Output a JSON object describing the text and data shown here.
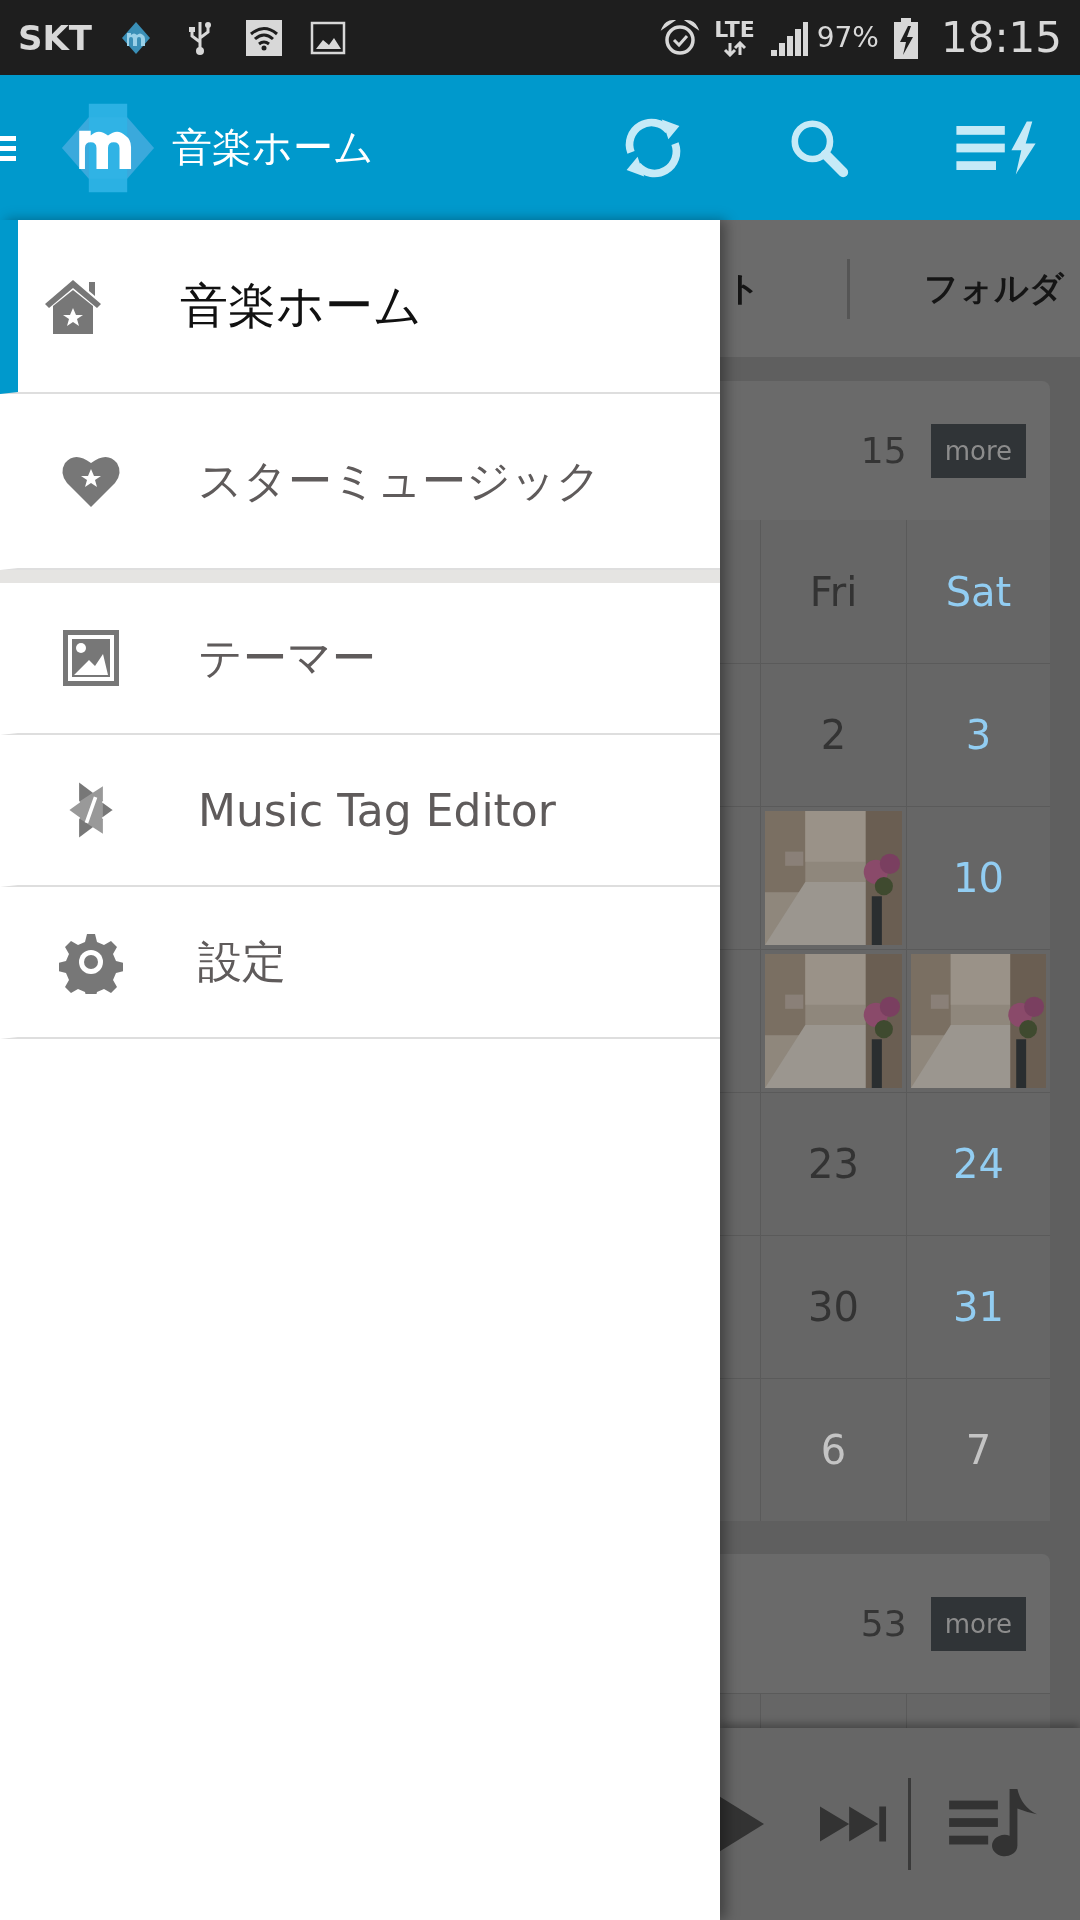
{
  "status_bar": {
    "carrier": "SKT",
    "network": "LTE",
    "battery": "97%",
    "time": "18:15"
  },
  "app_bar": {
    "title": "音楽ホーム"
  },
  "drawer": {
    "sections": [
      {
        "items": [
          {
            "label": "音楽ホーム",
            "selected": true
          },
          {
            "label": "スターミュージック",
            "selected": false
          }
        ]
      },
      {
        "items": [
          {
            "label": "テーマー",
            "selected": false
          },
          {
            "label": "Music Tag Editor",
            "selected": false
          },
          {
            "label": "設定",
            "selected": false
          }
        ]
      }
    ]
  },
  "tabs": [
    {
      "label": "ト"
    },
    {
      "label": "フォルダ"
    }
  ],
  "cards": [
    {
      "count": "15",
      "more": "more",
      "header": [
        {
          "label": "Fri",
          "kind": "weekday"
        },
        {
          "label": "Sat",
          "kind": "saturday"
        }
      ],
      "rows": [
        [
          {
            "label": "2",
            "kind": "weekday"
          },
          {
            "label": "3",
            "kind": "saturday"
          }
        ],
        [
          {
            "kind": "picture"
          },
          {
            "label": "10",
            "kind": "saturday"
          }
        ],
        [
          {
            "kind": "picture"
          },
          {
            "kind": "picture"
          }
        ],
        [
          {
            "label": "23",
            "kind": "weekday"
          },
          {
            "label": "24",
            "kind": "saturday"
          }
        ],
        [
          {
            "label": "30",
            "kind": "weekday"
          },
          {
            "label": "31",
            "kind": "saturday"
          }
        ],
        [
          {
            "label": "6",
            "kind": "muted"
          },
          {
            "label": "7",
            "kind": "muted"
          }
        ]
      ]
    },
    {
      "count": "53",
      "more": "more"
    }
  ]
}
